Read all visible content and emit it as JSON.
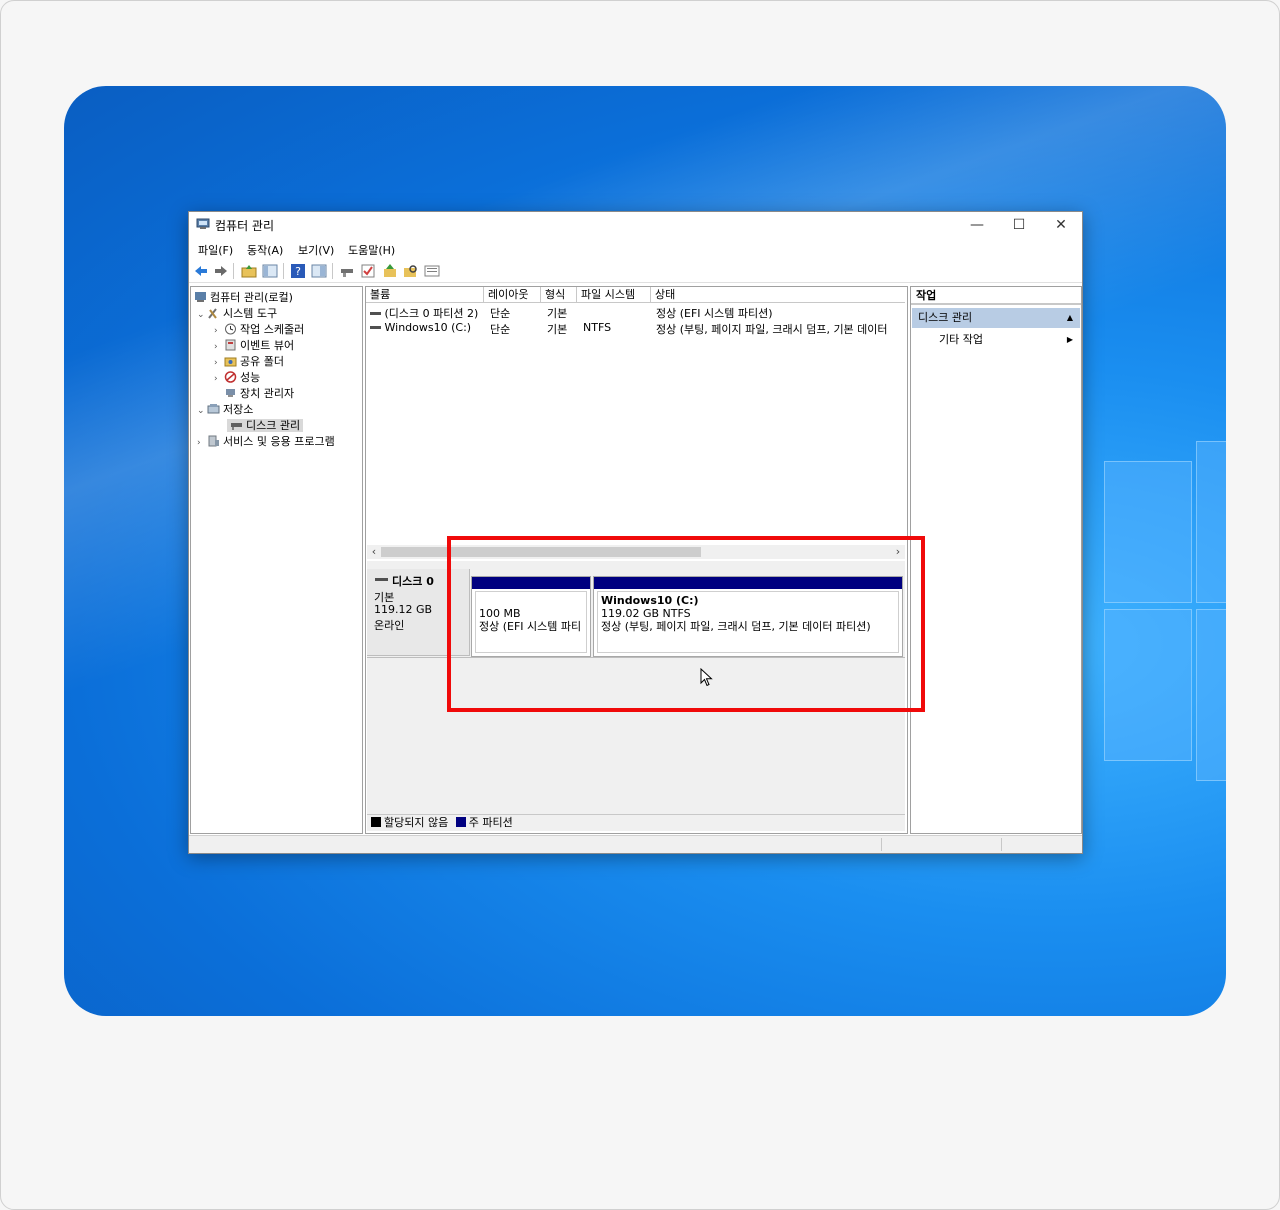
{
  "window": {
    "title": "컴퓨터 관리",
    "minimize": "—",
    "maximize": "☐",
    "close": "✕"
  },
  "menu": [
    "파일(F)",
    "동작(A)",
    "보기(V)",
    "도움말(H)"
  ],
  "tree": {
    "root": "컴퓨터 관리(로컬)",
    "system_tools": "시스템 도구",
    "task_scheduler": "작업 스케줄러",
    "event_viewer": "이벤트 뷰어",
    "shared_folders": "공유 폴더",
    "performance": "성능",
    "device_manager": "장치 관리자",
    "storage": "저장소",
    "disk_management": "디스크 관리",
    "services": "서비스 및 응용 프로그램"
  },
  "volume_list": {
    "columns": [
      "볼륨",
      "레이아웃",
      "형식",
      "파일 시스템",
      "상태"
    ],
    "rows": [
      {
        "volume": "(디스크 0 파티션 2)",
        "layout": "단순",
        "type": "기본",
        "fs": "",
        "status": "정상 (EFI 시스템 파티션)"
      },
      {
        "volume": "Windows10 (C:)",
        "layout": "단순",
        "type": "기본",
        "fs": "NTFS",
        "status": "정상 (부팅, 페이지 파일, 크래시 덤프, 기본 데이터"
      }
    ]
  },
  "disk": {
    "name": "디스크 0",
    "type": "기본",
    "size": "119.12 GB",
    "state": "온라인",
    "partitions": [
      {
        "title": "",
        "size": "100 MB",
        "status": "정상 (EFI 시스템 파티"
      },
      {
        "title": "Windows10  (C:)",
        "size": "119.02 GB NTFS",
        "status": "정상 (부팅, 페이지 파일, 크래시 덤프, 기본 데이터 파티션)"
      }
    ]
  },
  "legend": {
    "unallocated": "할당되지 않음",
    "primary": "주 파티션"
  },
  "actions": {
    "header": "작업",
    "section": "디스크 관리",
    "more": "기타 작업"
  },
  "colors": {
    "partition_bar": "#000080",
    "highlight": "#f00a0a",
    "action_section": "#b8cce4"
  }
}
